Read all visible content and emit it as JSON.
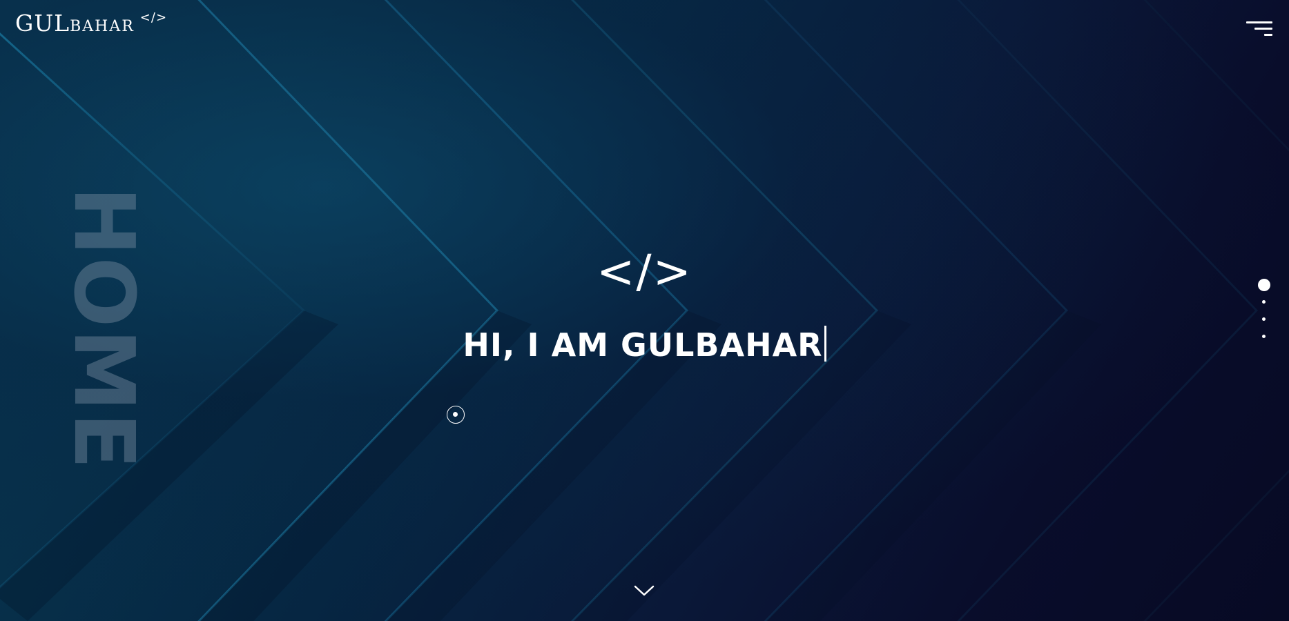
{
  "header": {
    "logo_main": "GUL",
    "logo_sub": "BAHAR",
    "logo_code": "</>",
    "menu_icon": "hamburger-menu-icon"
  },
  "section": {
    "label": "HOME"
  },
  "hero": {
    "code_symbol": "</>",
    "title": "HI, I AM GULBAHAR"
  },
  "pagination": {
    "active_index": 0,
    "count": 4
  },
  "scroll": {
    "icon": "chevron-down-icon"
  },
  "colors": {
    "text": "#ffffff",
    "bg_dark": "#070a24",
    "bg_teal": "#08344f",
    "label_faded": "#788ca0"
  }
}
